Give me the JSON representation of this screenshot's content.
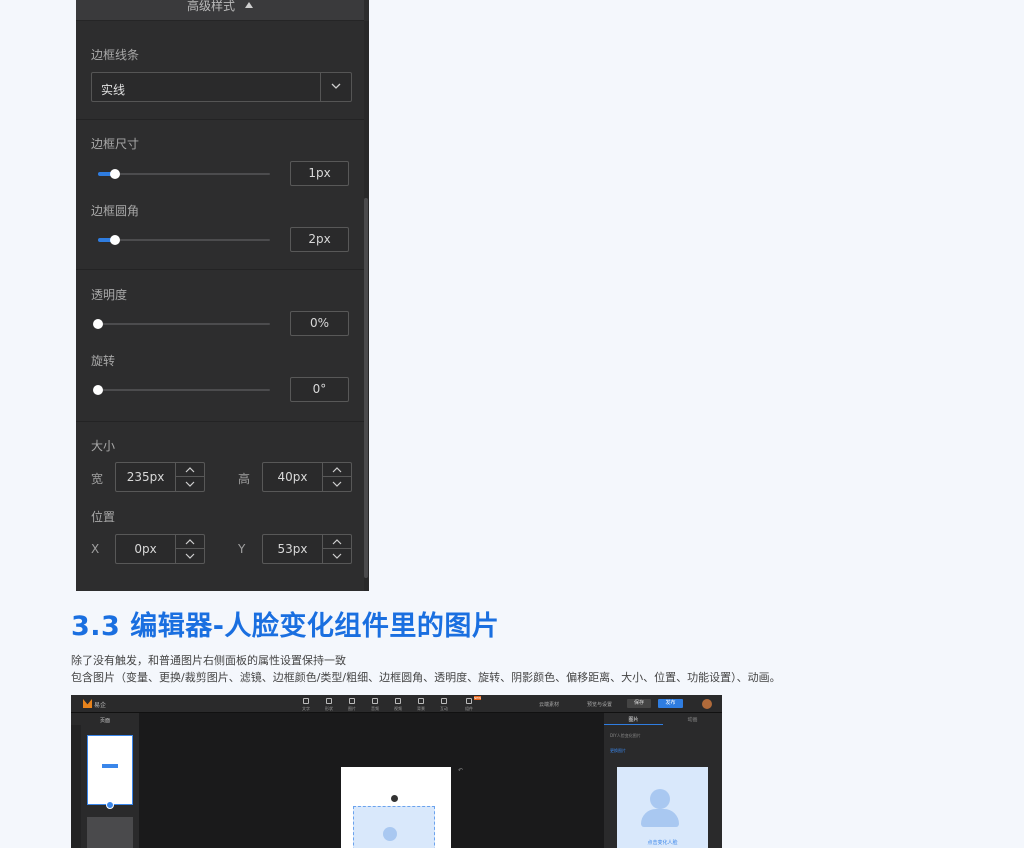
{
  "panel": {
    "header_title": "高级样式",
    "border_line": {
      "label": "边框线条",
      "selected": "实线"
    },
    "border_size": {
      "label": "边框尺寸",
      "value": "1px",
      "level": 0.1
    },
    "border_radius": {
      "label": "边框圆角",
      "value": "2px",
      "level": 0.1
    },
    "opacity": {
      "label": "透明度",
      "value": "0%",
      "level": 0.0
    },
    "rotate": {
      "label": "旋转",
      "value": "0°",
      "level": 0.0
    },
    "size": {
      "label": "大小",
      "width_label": "宽",
      "width_value": "235px",
      "height_label": "高",
      "height_value": "40px"
    },
    "position": {
      "label": "位置",
      "x_label": "X",
      "x_value": "0px",
      "y_label": "Y",
      "y_value": "53px"
    },
    "accent_color": "#2f7de1"
  },
  "section": {
    "heading": "3.3 编辑器-人脸变化组件里的图片",
    "line1": "除了没有触发，和普通图片右侧面板的属性设置保持一致",
    "line2": "包含图片（变量、更换/裁剪图片、滤镜、边框颜色/类型/粗细、边框圆角、透明度、旋转、阴影颜色、偏移距离、大小、位置、功能设置）、动画。"
  },
  "editor_screenshot": {
    "app_name": "易企",
    "toolbar": [
      "文字",
      "形状",
      "图片",
      "音频",
      "视频",
      "背景",
      "互动",
      "组件"
    ],
    "material_link": "云端素材",
    "preview_settings": "预览与设置",
    "save_button": "保存",
    "publish_button": "发布",
    "new_badge": "NEW",
    "pages_title": "页面",
    "right_tabs": [
      "图片",
      "动画"
    ],
    "right_line1": "DIY人脸变化图片",
    "right_line2": "更换图片",
    "face_caption": "点击变化人脸",
    "undo_icon": "↶"
  }
}
